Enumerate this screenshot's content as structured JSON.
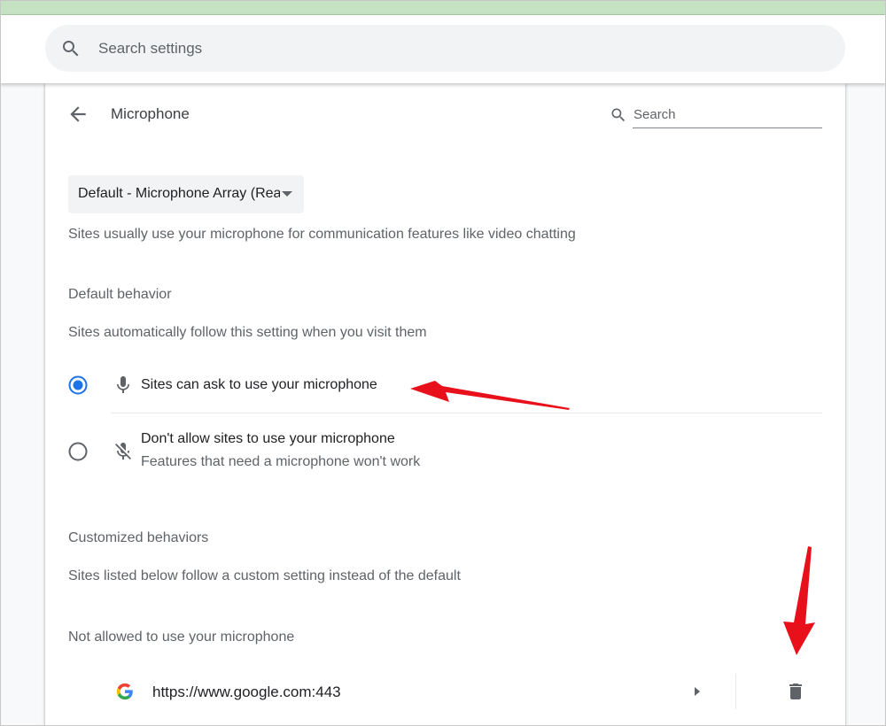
{
  "toolbar": {
    "search_placeholder": "Search settings"
  },
  "page": {
    "title": "Microphone",
    "search_placeholder": "Search"
  },
  "device_select": {
    "value": "Default - Microphone Array (Realtek(R) Audio)"
  },
  "description": "Sites usually use your microphone for communication features like video chatting",
  "default_behavior": {
    "heading": "Default behavior",
    "subtext": "Sites automatically follow this setting when you visit them",
    "options": [
      {
        "label": "Sites can ask to use your microphone",
        "selected": true,
        "icon": "mic-icon"
      },
      {
        "label": "Don't allow sites to use your microphone",
        "sublabel": "Features that need a microphone won't work",
        "selected": false,
        "icon": "mic-off-icon"
      }
    ]
  },
  "customized": {
    "heading": "Customized behaviors",
    "subtext": "Sites listed below follow a custom setting instead of the default",
    "blocked_heading": "Not allowed to use your microphone",
    "sites": [
      {
        "url": "https://www.google.com:443",
        "icon": "google-favicon"
      }
    ]
  },
  "colors": {
    "accent": "#1a73e8",
    "annotation_arrow": "#e8101b",
    "top_strip": "#c5e3c3"
  }
}
